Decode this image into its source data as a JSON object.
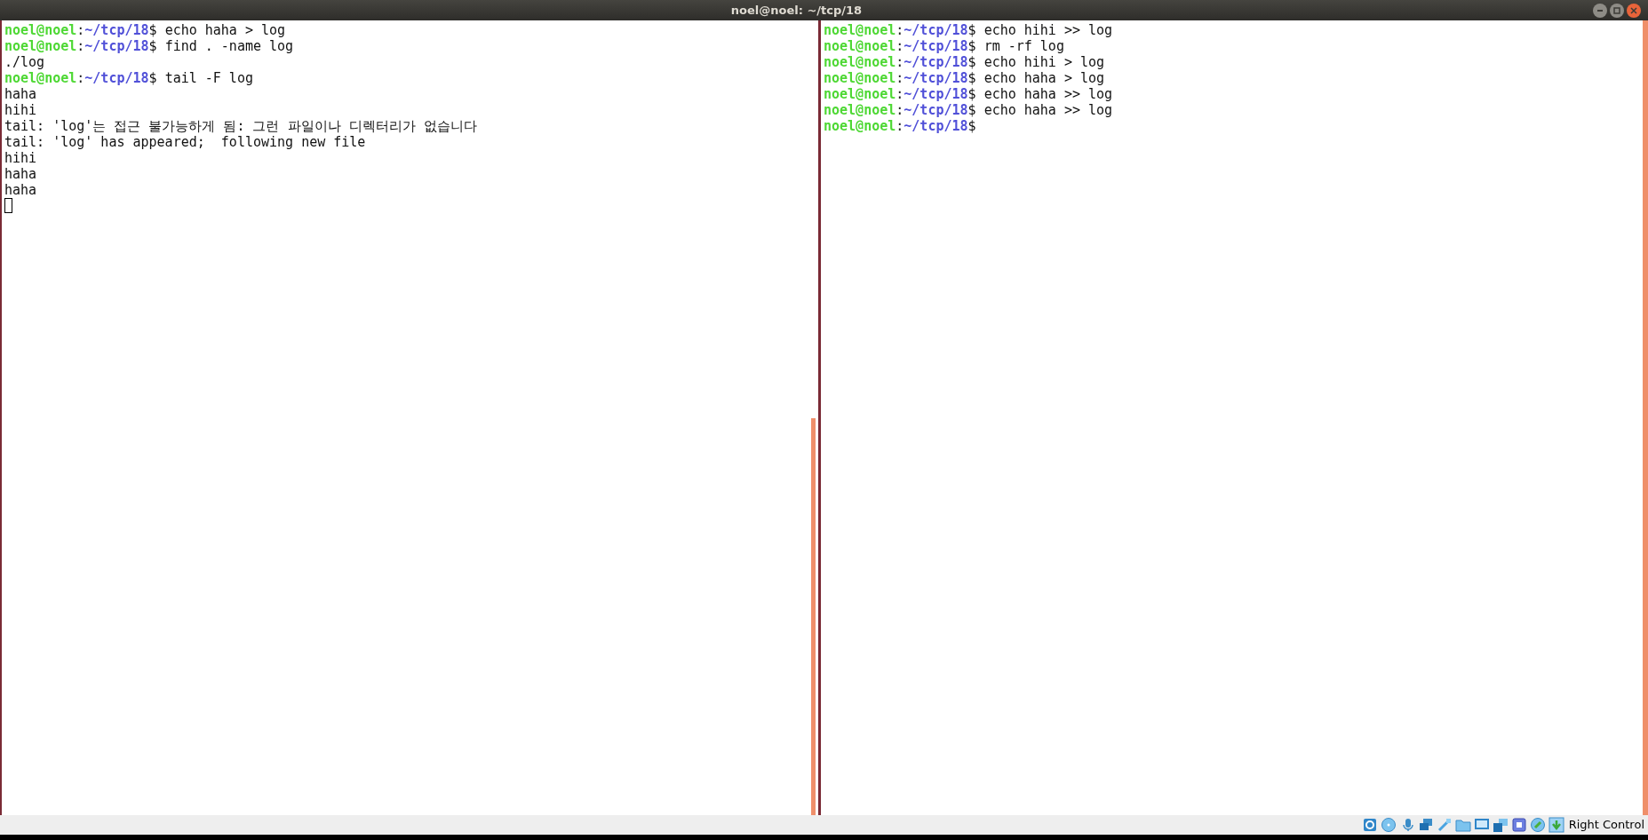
{
  "window": {
    "title": "noel@noel: ~/tcp/18"
  },
  "left_pane": {
    "lines": [
      {
        "kind": "prompt",
        "user": "noel@noel",
        "separator": ":",
        "path": "~/tcp/18",
        "symbol": "$",
        "command": "echo haha > log"
      },
      {
        "kind": "prompt",
        "user": "noel@noel",
        "separator": ":",
        "path": "~/tcp/18",
        "symbol": "$",
        "command": "find . -name log"
      },
      {
        "kind": "output",
        "text": "./log"
      },
      {
        "kind": "prompt",
        "user": "noel@noel",
        "separator": ":",
        "path": "~/tcp/18",
        "symbol": "$",
        "command": "tail -F log"
      },
      {
        "kind": "output",
        "text": "haha"
      },
      {
        "kind": "output",
        "text": "hihi"
      },
      {
        "kind": "output",
        "text": "tail: 'log'는 접근 불가능하게 됨: 그런 파일이나 디렉터리가 없습니다"
      },
      {
        "kind": "output",
        "text": "tail: 'log' has appeared;  following new file"
      },
      {
        "kind": "output",
        "text": "hihi"
      },
      {
        "kind": "output",
        "text": "haha"
      },
      {
        "kind": "output",
        "text": "haha"
      },
      {
        "kind": "cursor"
      }
    ]
  },
  "right_pane": {
    "lines": [
      {
        "kind": "prompt",
        "user": "noel@noel",
        "separator": ":",
        "path": "~/tcp/18",
        "symbol": "$",
        "command": "echo hihi >> log"
      },
      {
        "kind": "prompt",
        "user": "noel@noel",
        "separator": ":",
        "path": "~/tcp/18",
        "symbol": "$",
        "command": "rm -rf log"
      },
      {
        "kind": "prompt",
        "user": "noel@noel",
        "separator": ":",
        "path": "~/tcp/18",
        "symbol": "$",
        "command": "echo hihi > log"
      },
      {
        "kind": "prompt",
        "user": "noel@noel",
        "separator": ":",
        "path": "~/tcp/18",
        "symbol": "$",
        "command": "echo haha > log"
      },
      {
        "kind": "prompt",
        "user": "noel@noel",
        "separator": ":",
        "path": "~/tcp/18",
        "symbol": "$",
        "command": "echo haha >> log"
      },
      {
        "kind": "prompt",
        "user": "noel@noel",
        "separator": ":",
        "path": "~/tcp/18",
        "symbol": "$",
        "command": "echo haha >> log"
      },
      {
        "kind": "prompt",
        "user": "noel@noel",
        "separator": ":",
        "path": "~/tcp/18",
        "symbol": "$"
      }
    ]
  },
  "status_bar": {
    "host_key": "Right Control"
  }
}
